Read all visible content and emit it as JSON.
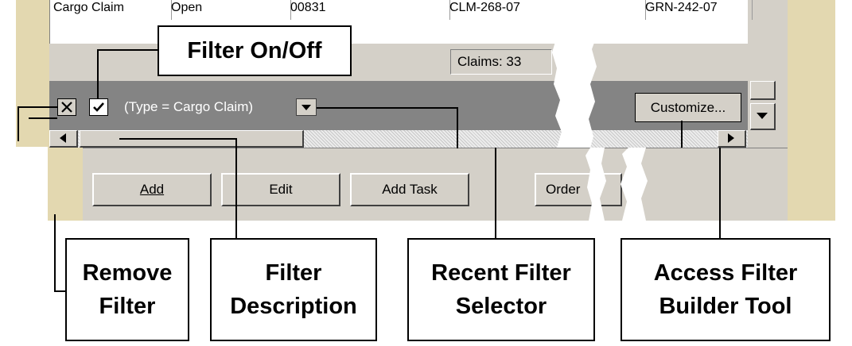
{
  "grid_row": {
    "type": "Cargo Claim",
    "status": "Open",
    "code": "00831",
    "claim": "CLM-268-07",
    "ref": "GRN-242-07"
  },
  "status": {
    "claims_count": "Claims: 33"
  },
  "filter_bar": {
    "description": "(Type = Cargo Claim)",
    "customize_label": "Customize..."
  },
  "buttons": {
    "add": "Add",
    "edit": "Edit",
    "add_task": "Add Task",
    "order": "Order"
  },
  "callouts": {
    "filter_on_off": "Filter On/Off",
    "remove_filter_1": "Remove",
    "remove_filter_2": "Filter",
    "filter_description_1": "Filter",
    "filter_description_2": "Description",
    "recent_filter_1": "Recent Filter",
    "recent_filter_2": "Selector",
    "access_builder_1": "Access Filter",
    "access_builder_2": "Builder Tool"
  },
  "colors": {
    "window_face": "#d4d0c8",
    "filter_bar": "#848484",
    "frame": "#e3d8b0"
  }
}
